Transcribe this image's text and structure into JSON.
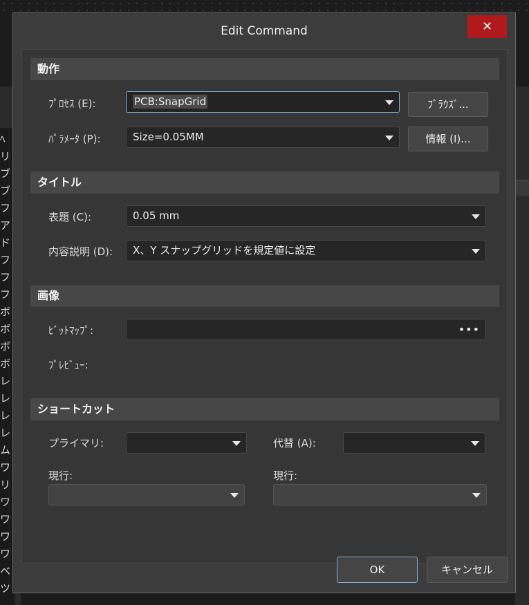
{
  "dialog": {
    "title": "Edit Command",
    "close_glyph": "✕"
  },
  "background": {
    "side_letters": [
      "ﾍ",
      "リ",
      "ブ",
      "ブ",
      "フ",
      "ア",
      "ド",
      "フ",
      "フ",
      "フ",
      "ボ",
      "ボ",
      "ボ",
      "ボ",
      "レ",
      "レ",
      "レ",
      "レ",
      "ム",
      "ワ",
      "リ",
      "ワ",
      "ワ",
      "ワ",
      "ワ",
      "ベ",
      "ツ"
    ]
  },
  "sections": {
    "action": {
      "header": "動作",
      "process_label": "ﾌﾟﾛｾｽ (E):",
      "process_value": "PCB:SnapGrid",
      "browse_button": "ﾌﾞﾗｳｽﾞ...",
      "parameter_label": "ﾊﾟﾗﾒｰﾀ (P):",
      "parameter_value": "Size=0.05MM",
      "info_button": "情報 (I)..."
    },
    "title": {
      "header": "タイトル",
      "caption_label": "表題 (C):",
      "caption_value": "0.05 mm",
      "description_label": "内容説明 (D):",
      "description_value": "X、Y スナップグリッドを規定値に設定"
    },
    "image": {
      "header": "画像",
      "bitmap_label": "ﾋﾞｯﾄﾏｯﾌﾟ:",
      "bitmap_value": "",
      "bitmap_dots": "•••",
      "preview_label": "ﾌﾟﾚﾋﾞｭｰ:"
    },
    "shortcut": {
      "header": "ショートカット",
      "primary_label": "プライマリ:",
      "primary_value": "",
      "alternate_label": "代替 (A):",
      "alternate_value": "",
      "current_label_left": "現行:",
      "current_label_right": "現行:"
    }
  },
  "footer": {
    "ok_button": "OK",
    "cancel_button": "キャンセル"
  }
}
